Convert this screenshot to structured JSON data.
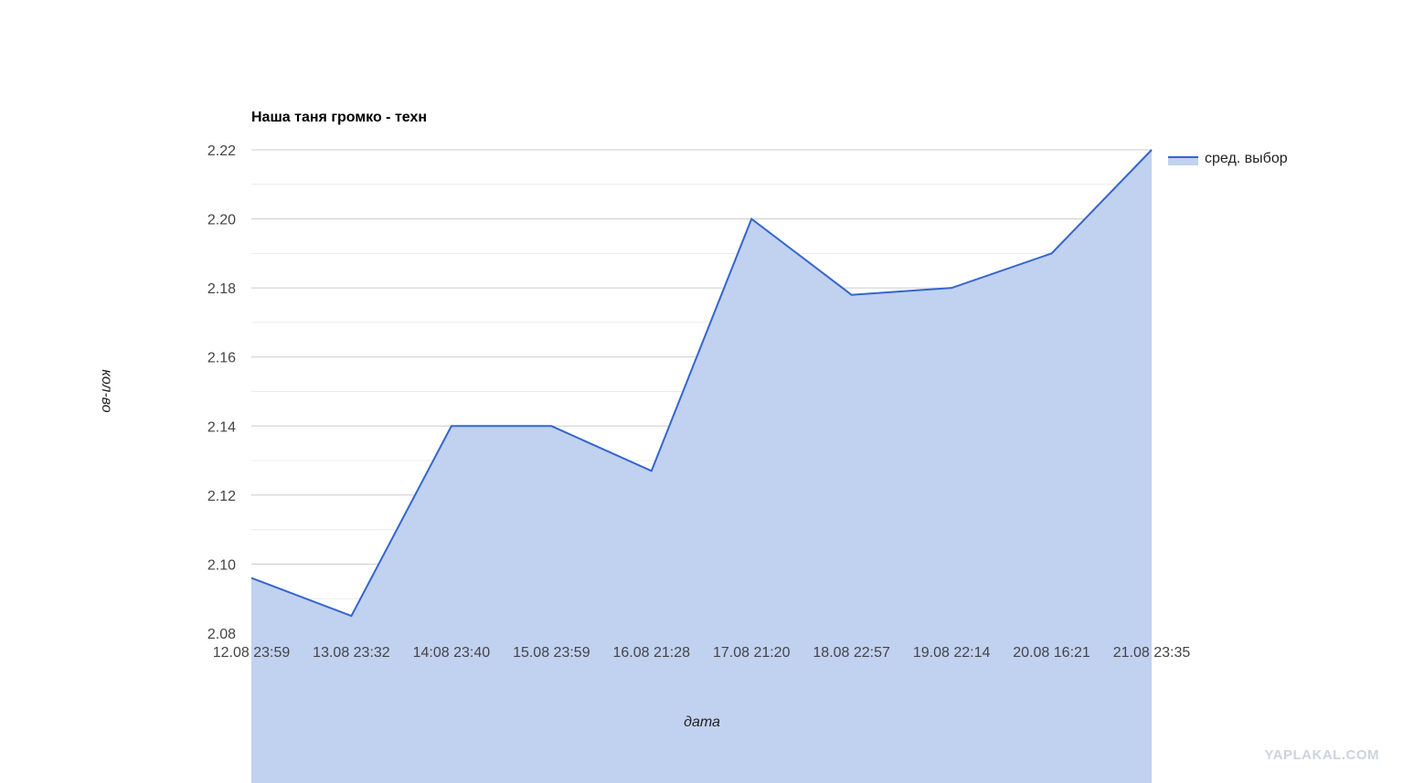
{
  "chart_data": {
    "type": "area",
    "title": "Наша таня громко - техн",
    "xlabel": "дата",
    "ylabel": "кол-во",
    "categories": [
      "12.08 23:59",
      "13.08 23:32",
      "14:08 23:40",
      "15.08 23:59",
      "16.08 21:28",
      "17.08 21:20",
      "18.08 22:57",
      "19.08 22:14",
      "20.08 16:21",
      "21.08 23:35"
    ],
    "series": [
      {
        "name": "сред. выбор",
        "values": [
          2.096,
          2.085,
          2.14,
          2.14,
          2.127,
          2.2,
          2.178,
          2.18,
          2.19,
          2.22
        ]
      }
    ],
    "ylim": [
      2.08,
      2.22
    ],
    "yticks": [
      "2.08",
      "2.10",
      "2.12",
      "2.14",
      "2.16",
      "2.18",
      "2.20",
      "2.22"
    ],
    "grid": true,
    "legend": "right",
    "colors": {
      "line": "#3366cc",
      "fill": "#c1d1f0",
      "grid_major": "#cccccc",
      "grid_minor": "#ebebeb"
    }
  },
  "watermark": "YAPLAKAL.COM"
}
